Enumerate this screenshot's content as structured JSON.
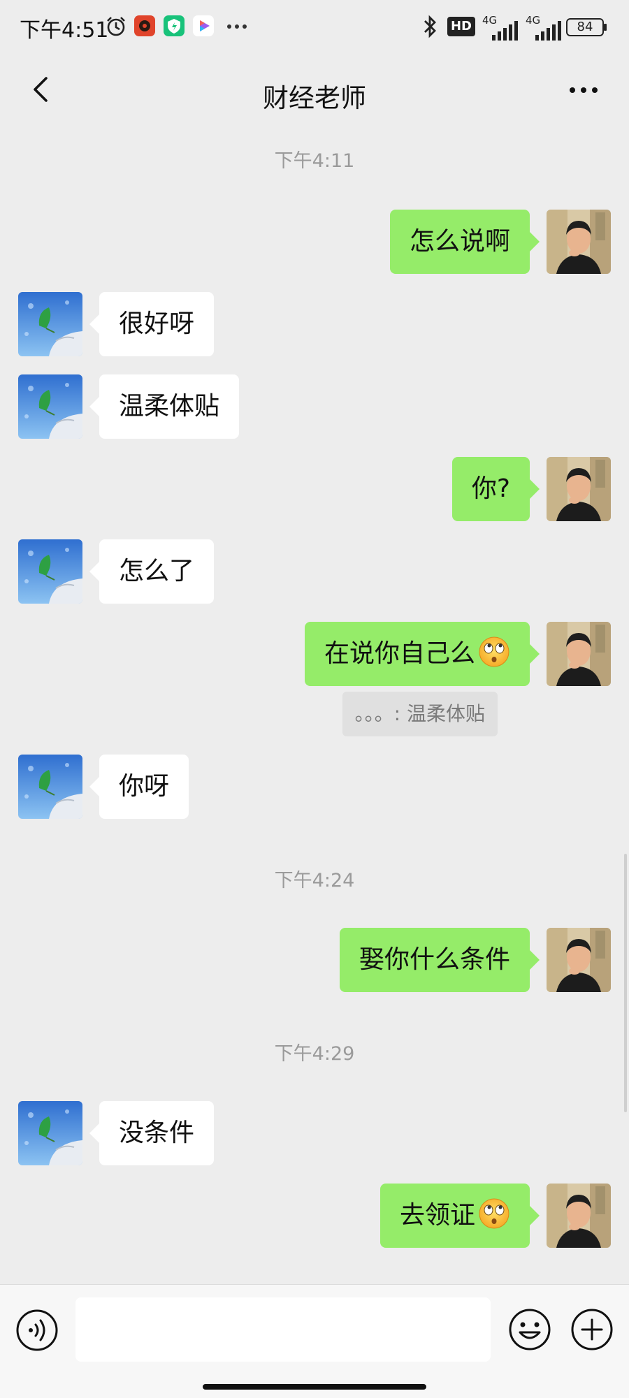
{
  "status_bar": {
    "time": "下午4:51",
    "hd_label": "HD",
    "net1": "4G",
    "net2": "4G",
    "battery": "84"
  },
  "header": {
    "title": "财经老师"
  },
  "messages": [
    {
      "type": "time",
      "text": "下午4:11"
    },
    {
      "type": "out",
      "text": "怎么说啊"
    },
    {
      "type": "in",
      "text": "很好呀"
    },
    {
      "type": "in",
      "text": "温柔体贴"
    },
    {
      "type": "out",
      "text": "你?"
    },
    {
      "type": "in",
      "text": "怎么了"
    },
    {
      "type": "out",
      "text": "在说你自己么",
      "emoji": "rolling-eyes-emoji"
    },
    {
      "type": "quote",
      "text": "。。。: 温柔体贴"
    },
    {
      "type": "in",
      "text": "你呀"
    },
    {
      "type": "time",
      "text": "下午4:24"
    },
    {
      "type": "out",
      "text": "娶你什么条件"
    },
    {
      "type": "time",
      "text": "下午4:29"
    },
    {
      "type": "in",
      "text": "没条件"
    },
    {
      "type": "out",
      "text": "去领证",
      "emoji": "rolling-eyes-emoji"
    }
  ],
  "input_bar": {
    "placeholder": ""
  },
  "colors": {
    "background": "#ededed",
    "outgoing_bubble": "#95ec69",
    "incoming_bubble": "#ffffff"
  },
  "icons": [
    "back-arrow-icon",
    "more-dots-icon",
    "voice-icon",
    "emoji-icon",
    "plus-icon",
    "bluetooth-icon",
    "alarm-icon"
  ]
}
